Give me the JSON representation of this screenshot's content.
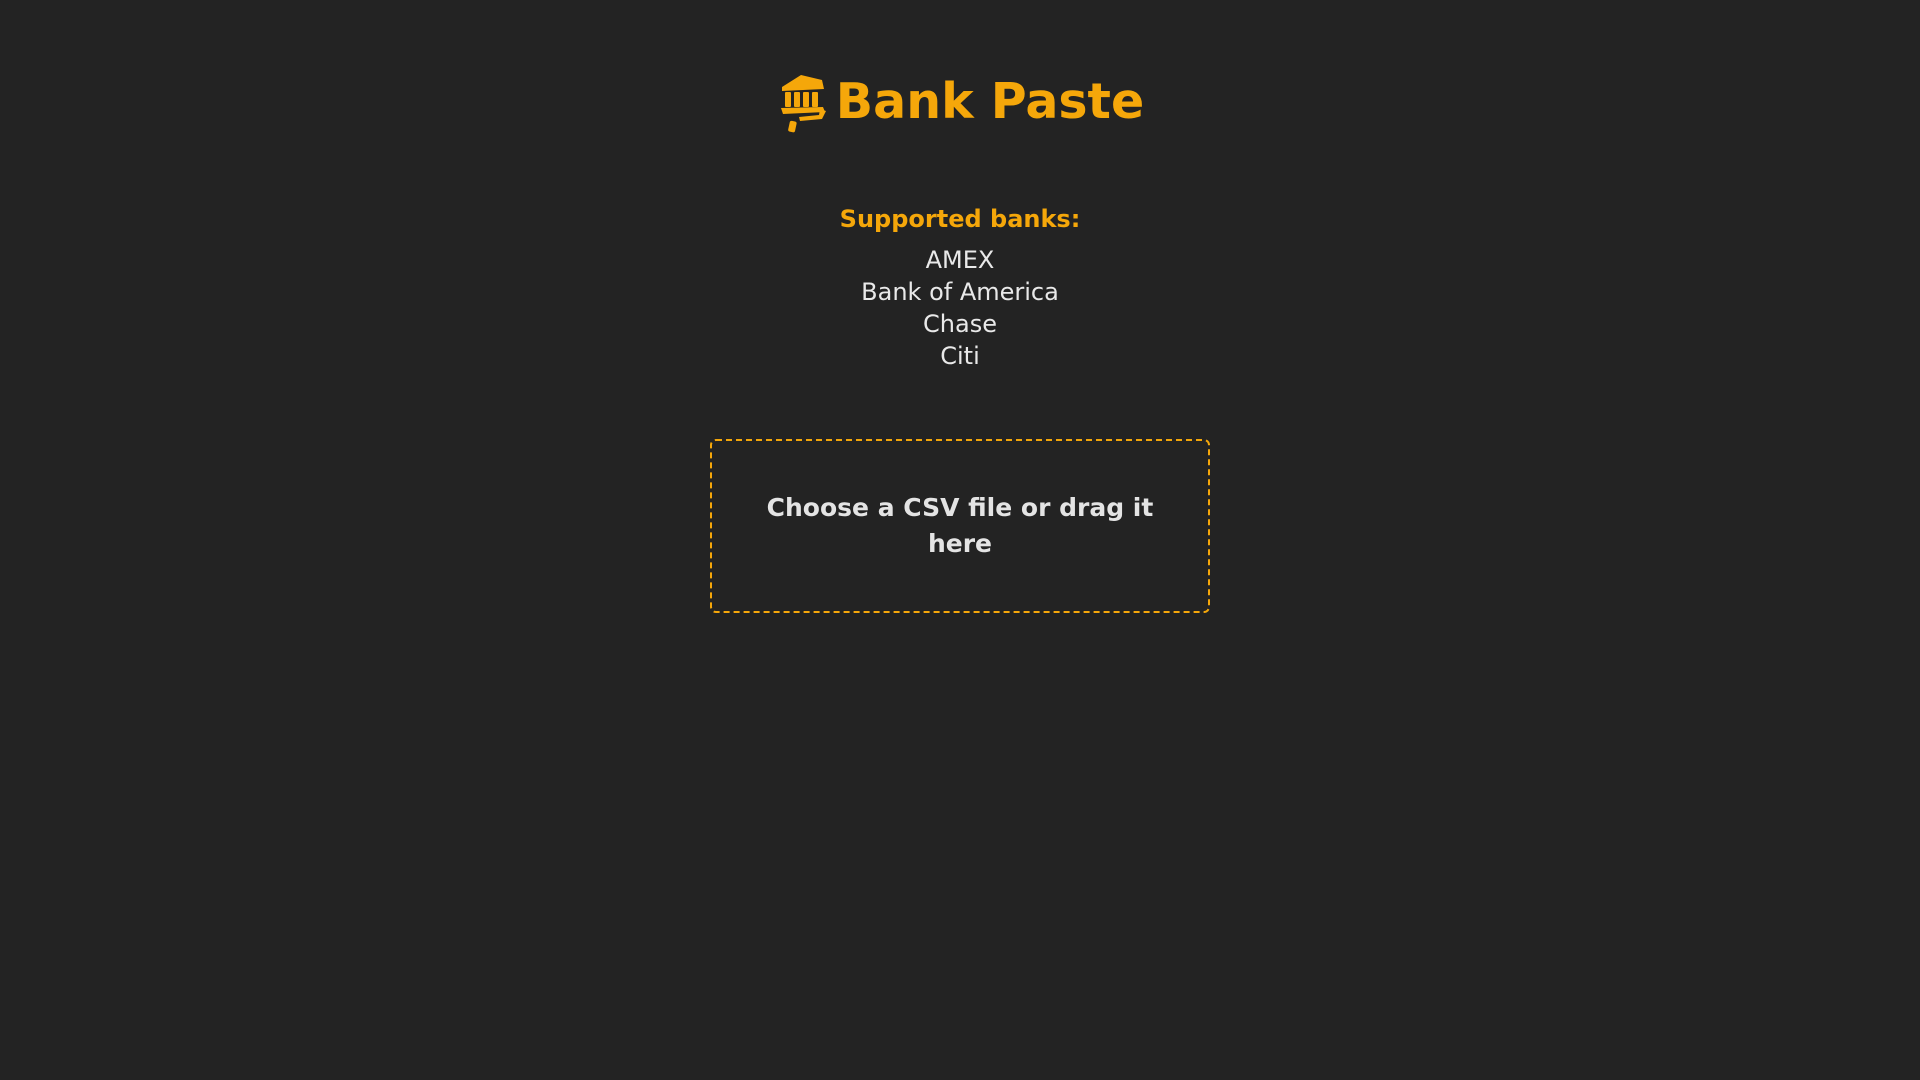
{
  "colors": {
    "accent": "#f5a70a",
    "background": "#232323",
    "text": "#e9e9e9"
  },
  "header": {
    "icon": "bank-paint-roller-icon",
    "title": "Bank Paste"
  },
  "supported_banks": {
    "heading": "Supported banks:",
    "items": [
      "AMEX",
      "Bank of America",
      "Chase",
      "Citi"
    ]
  },
  "dropzone": {
    "label": "Choose a CSV file or drag it here"
  }
}
